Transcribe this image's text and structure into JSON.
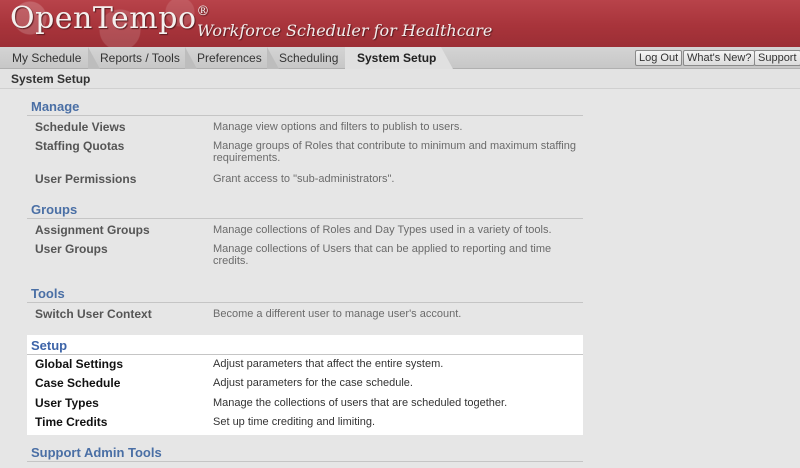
{
  "header": {
    "logo": "OpenTempo",
    "logo_mark": "®",
    "tagline": "Workforce Scheduler for Healthcare"
  },
  "nav": {
    "tabs": [
      {
        "label": "My Schedule",
        "active": false
      },
      {
        "label": "Reports / Tools",
        "active": false
      },
      {
        "label": "Preferences",
        "active": false
      },
      {
        "label": "Scheduling",
        "active": false
      },
      {
        "label": "System Setup",
        "active": true
      }
    ],
    "buttons": {
      "logout": "Log Out",
      "whats_new": "What's New?",
      "support": "Support"
    }
  },
  "breadcrumb": "System Setup",
  "sections": [
    {
      "title": "Manage",
      "items": [
        {
          "name": "Schedule Views",
          "desc": "Manage view options and filters to publish to users."
        },
        {
          "name": "Staffing Quotas",
          "desc": "Manage groups of Roles that contribute to minimum and maximum staffing requirements."
        },
        {
          "name": "User Permissions",
          "desc": "Grant access to \"sub-administrators\"."
        }
      ]
    },
    {
      "title": "Groups",
      "items": [
        {
          "name": "Assignment Groups",
          "desc": "Manage collections of Roles and Day Types used in a variety of tools."
        },
        {
          "name": "User Groups",
          "desc": "Manage collections of Users that can be applied to reporting and time credits."
        }
      ]
    },
    {
      "title": "Tools",
      "items": [
        {
          "name": "Switch User Context",
          "desc": "Become a different user to manage user's account."
        }
      ]
    },
    {
      "title": "Setup",
      "highlighted": true,
      "items": [
        {
          "name": "Global Settings",
          "desc": "Adjust parameters that affect the entire system."
        },
        {
          "name": "Case Schedule",
          "desc": "Adjust parameters for the case schedule."
        },
        {
          "name": "User Types",
          "desc": "Manage the collections of users that are scheduled together."
        },
        {
          "name": "Time Credits",
          "desc": "Set up time crediting and limiting."
        }
      ]
    },
    {
      "title": "Support Admin Tools",
      "items": []
    }
  ],
  "colors": {
    "banner": "#a8343b",
    "section_title": "#4a6fa5",
    "highlight_bg": "#ffffff"
  }
}
